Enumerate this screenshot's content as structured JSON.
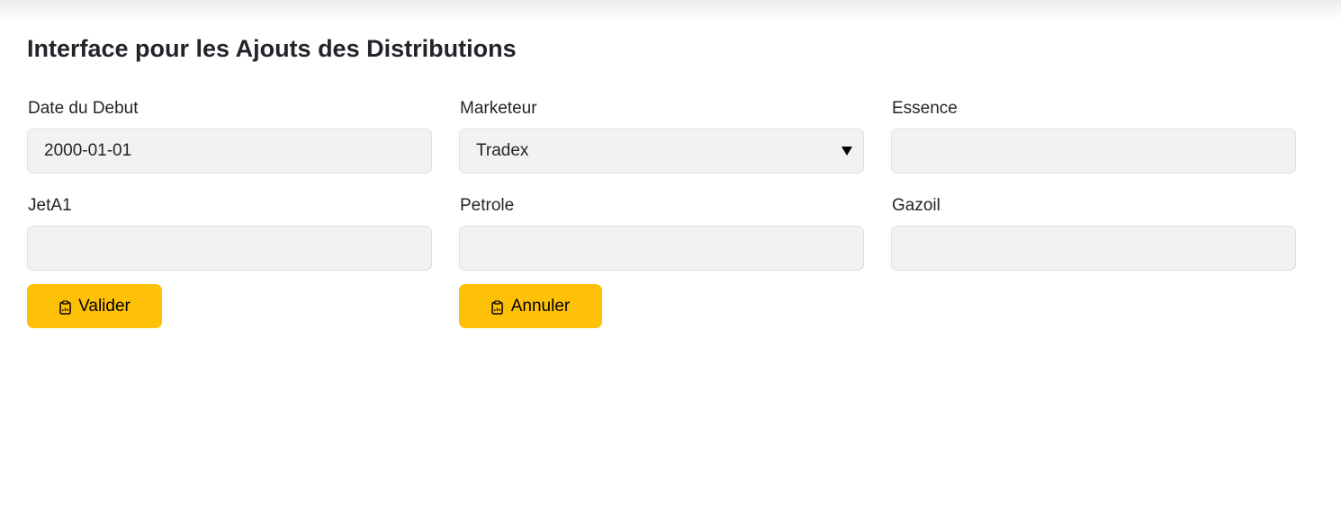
{
  "page": {
    "title": "Interface pour les Ajouts des Distributions"
  },
  "form": {
    "date_debut": {
      "label": "Date du Debut",
      "value": "2000-01-01"
    },
    "marketeur": {
      "label": "Marketeur",
      "selected": "Tradex"
    },
    "essence": {
      "label": "Essence",
      "value": ""
    },
    "jeta1": {
      "label": "JetA1",
      "value": ""
    },
    "petrole": {
      "label": "Petrole",
      "value": ""
    },
    "gazoil": {
      "label": "Gazoil",
      "value": ""
    }
  },
  "buttons": {
    "valider": {
      "label": "Valider",
      "icon": "clipboard-icon"
    },
    "annuler": {
      "label": "Annuler",
      "icon": "clipboard-icon"
    }
  },
  "colors": {
    "button_bg": "#ffc107",
    "input_bg": "#f2f2f2",
    "text": "#212529"
  }
}
